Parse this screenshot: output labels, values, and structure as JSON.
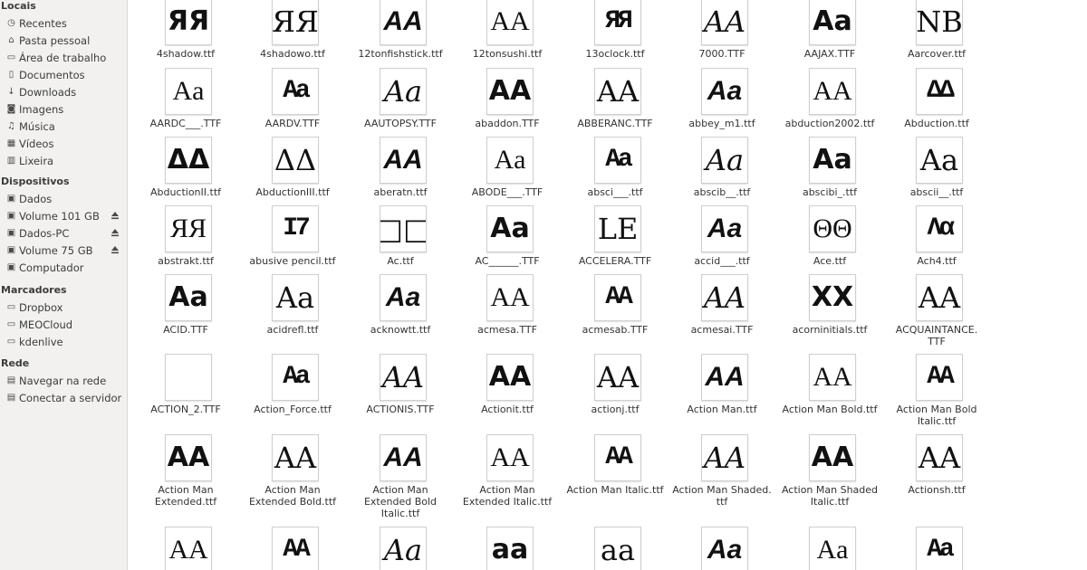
{
  "sidebar": {
    "sections": [
      {
        "title": "Locais",
        "items": [
          {
            "label": "Recentes",
            "icon": "clock-icon"
          },
          {
            "label": "Pasta pessoal",
            "icon": "home-icon"
          },
          {
            "label": "Área de trabalho",
            "icon": "folder-icon"
          },
          {
            "label": "Documentos",
            "icon": "document-icon"
          },
          {
            "label": "Downloads",
            "icon": "download-icon"
          },
          {
            "label": "Imagens",
            "icon": "camera-icon"
          },
          {
            "label": "Música",
            "icon": "music-icon"
          },
          {
            "label": "Vídeos",
            "icon": "film-icon"
          },
          {
            "label": "Lixeira",
            "icon": "trash-icon"
          }
        ]
      },
      {
        "title": "Dispositivos",
        "items": [
          {
            "label": "Dados",
            "icon": "drive-icon"
          },
          {
            "label": "Volume 101 GB",
            "icon": "drive-icon",
            "eject": true
          },
          {
            "label": "Dados-PC",
            "icon": "drive-icon",
            "eject": true
          },
          {
            "label": "Volume 75 GB",
            "icon": "drive-icon",
            "eject": true
          },
          {
            "label": "Computador",
            "icon": "drive-icon"
          }
        ]
      },
      {
        "title": "Marcadores",
        "items": [
          {
            "label": "Dropbox",
            "icon": "folder-icon"
          },
          {
            "label": "MEOCloud",
            "icon": "folder-icon"
          },
          {
            "label": "kdenlive",
            "icon": "folder-icon"
          }
        ]
      },
      {
        "title": "Rede",
        "items": [
          {
            "label": "Navegar na rede",
            "icon": "network-icon"
          },
          {
            "label": "Conectar a servidor",
            "icon": "server-icon"
          }
        ]
      }
    ]
  },
  "files": [
    [
      {
        "name": "4shadow.ttf",
        "preview": "ЯЯ"
      },
      {
        "name": "4shadowo.ttf",
        "preview": "ЯЯ"
      },
      {
        "name": "12tonfishstick.ttf",
        "preview": "AA"
      },
      {
        "name": "12tonsushi.ttf",
        "preview": "AA"
      },
      {
        "name": "13oclock.ttf",
        "preview": "ЯЯ"
      },
      {
        "name": "7000.TTF",
        "preview": "AA"
      },
      {
        "name": "AAJAX.TTF",
        "preview": "Aa"
      },
      {
        "name": "Aarcover.ttf",
        "preview": "NB"
      }
    ],
    [
      {
        "name": "AARDC___.TTF",
        "preview": "Aa"
      },
      {
        "name": "AARDV.TTF",
        "preview": "Aa"
      },
      {
        "name": "AAUTOPSY.TTF",
        "preview": "Aa"
      },
      {
        "name": "abaddon.TTF",
        "preview": "AA"
      },
      {
        "name": "ABBERANC.TTF",
        "preview": "AA"
      },
      {
        "name": "abbey_m1.ttf",
        "preview": "Aa"
      },
      {
        "name": "abduction2002.ttf",
        "preview": "AA"
      },
      {
        "name": "Abduction.ttf",
        "preview": "ΔΔ"
      }
    ],
    [
      {
        "name": "AbductionII.ttf",
        "preview": "ΔΔ"
      },
      {
        "name": "AbductionIII.ttf",
        "preview": "ΔΔ"
      },
      {
        "name": "aberatn.ttf",
        "preview": "AA"
      },
      {
        "name": "ABODE___.TTF",
        "preview": "Aa"
      },
      {
        "name": "absci___.ttf",
        "preview": "Aa"
      },
      {
        "name": "abscib__.ttf",
        "preview": "Aa"
      },
      {
        "name": "abscibi_.ttf",
        "preview": "Aa"
      },
      {
        "name": "abscii__.ttf",
        "preview": "Aa"
      }
    ],
    [
      {
        "name": "abstrakt.ttf",
        "preview": "ЯЯ"
      },
      {
        "name": "abusive pencil.ttf",
        "preview": "I7"
      },
      {
        "name": "Ac.ttf",
        "preview": "□□"
      },
      {
        "name": "AC______.TTF",
        "preview": "Aa"
      },
      {
        "name": "ACCELERA.TTF",
        "preview": "LE"
      },
      {
        "name": "accid___.ttf",
        "preview": "Aa"
      },
      {
        "name": "Ace.ttf",
        "preview": "ΘΘ"
      },
      {
        "name": "Ach4.ttf",
        "preview": "Λα"
      }
    ],
    [
      {
        "name": "ACID.TTF",
        "preview": "Aa"
      },
      {
        "name": "acidrefl.ttf",
        "preview": "Aa"
      },
      {
        "name": "acknowtt.ttf",
        "preview": "Aa"
      },
      {
        "name": "acmesa.TTF",
        "preview": "AA"
      },
      {
        "name": "acmesab.TTF",
        "preview": "AA"
      },
      {
        "name": "acmesai.TTF",
        "preview": "AA"
      },
      {
        "name": "acorninitials.ttf",
        "preview": "XX"
      },
      {
        "name": "ACQUAINTANCE.\nTTF",
        "preview": "AA"
      }
    ],
    [
      {
        "name": "ACTION_2.TTF",
        "preview": ""
      },
      {
        "name": "Action_Force.ttf",
        "preview": "Aa"
      },
      {
        "name": "ACTIONIS.TTF",
        "preview": "AA"
      },
      {
        "name": "Actionit.ttf",
        "preview": "AA"
      },
      {
        "name": "actionj.ttf",
        "preview": "AA"
      },
      {
        "name": "Action Man.ttf",
        "preview": "AA"
      },
      {
        "name": "Action Man Bold.ttf",
        "preview": "AA"
      },
      {
        "name": "Action Man Bold\nItalic.ttf",
        "preview": "AA"
      }
    ],
    [
      {
        "name": "Action Man\nExtended.ttf",
        "preview": "AA"
      },
      {
        "name": "Action Man\nExtended Bold.ttf",
        "preview": "AA"
      },
      {
        "name": "Action Man\nExtended Bold\nItalic.ttf",
        "preview": "AA"
      },
      {
        "name": "Action Man\nExtended Italic.ttf",
        "preview": "AA"
      },
      {
        "name": "Action Man Italic.ttf",
        "preview": "AA"
      },
      {
        "name": "Action Man Shaded.\nttf",
        "preview": "AA"
      },
      {
        "name": "Action Man Shaded\nItalic.ttf",
        "preview": "AA"
      },
      {
        "name": "Actionsh.ttf",
        "preview": "AA"
      }
    ],
    [
      {
        "name": "",
        "preview": "AA"
      },
      {
        "name": "",
        "preview": "AA"
      },
      {
        "name": "",
        "preview": "Aa"
      },
      {
        "name": "",
        "preview": "aa"
      },
      {
        "name": "",
        "preview": "aa"
      },
      {
        "name": "",
        "preview": "Aa"
      },
      {
        "name": "",
        "preview": "Aa"
      },
      {
        "name": "",
        "preview": "Aa"
      }
    ]
  ]
}
